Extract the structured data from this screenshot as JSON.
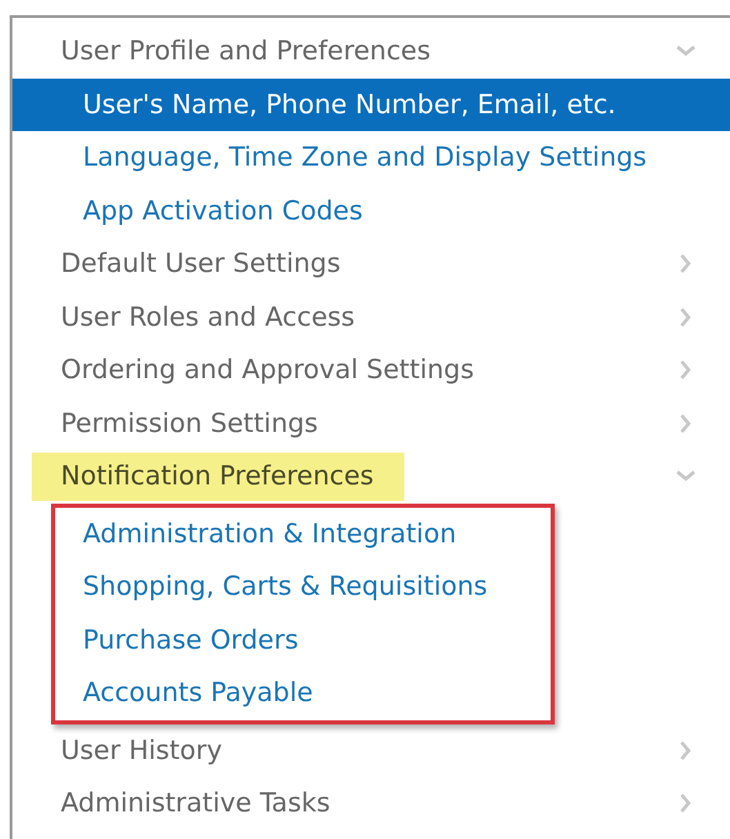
{
  "menu": [
    {
      "label": "User Profile and Preferences",
      "expanded": true,
      "highlighted": false,
      "children": [
        {
          "label": "User's Name, Phone Number, Email, etc.",
          "selected": true
        },
        {
          "label": "Language, Time Zone and Display Settings",
          "selected": false
        },
        {
          "label": "App Activation Codes",
          "selected": false
        }
      ]
    },
    {
      "label": "Default User Settings",
      "expanded": false,
      "highlighted": false
    },
    {
      "label": "User Roles and Access",
      "expanded": false,
      "highlighted": false
    },
    {
      "label": "Ordering and Approval Settings",
      "expanded": false,
      "highlighted": false
    },
    {
      "label": "Permission Settings",
      "expanded": false,
      "highlighted": false
    },
    {
      "label": "Notification Preferences",
      "expanded": true,
      "highlighted": true,
      "outlined": true,
      "children": [
        {
          "label": "Administration & Integration",
          "selected": false
        },
        {
          "label": "Shopping, Carts & Requisitions",
          "selected": false
        },
        {
          "label": "Purchase Orders",
          "selected": false
        },
        {
          "label": "Accounts Payable",
          "selected": false
        }
      ]
    },
    {
      "label": "User History",
      "expanded": false,
      "highlighted": false
    },
    {
      "label": "Administrative Tasks",
      "expanded": false,
      "highlighted": false
    }
  ]
}
